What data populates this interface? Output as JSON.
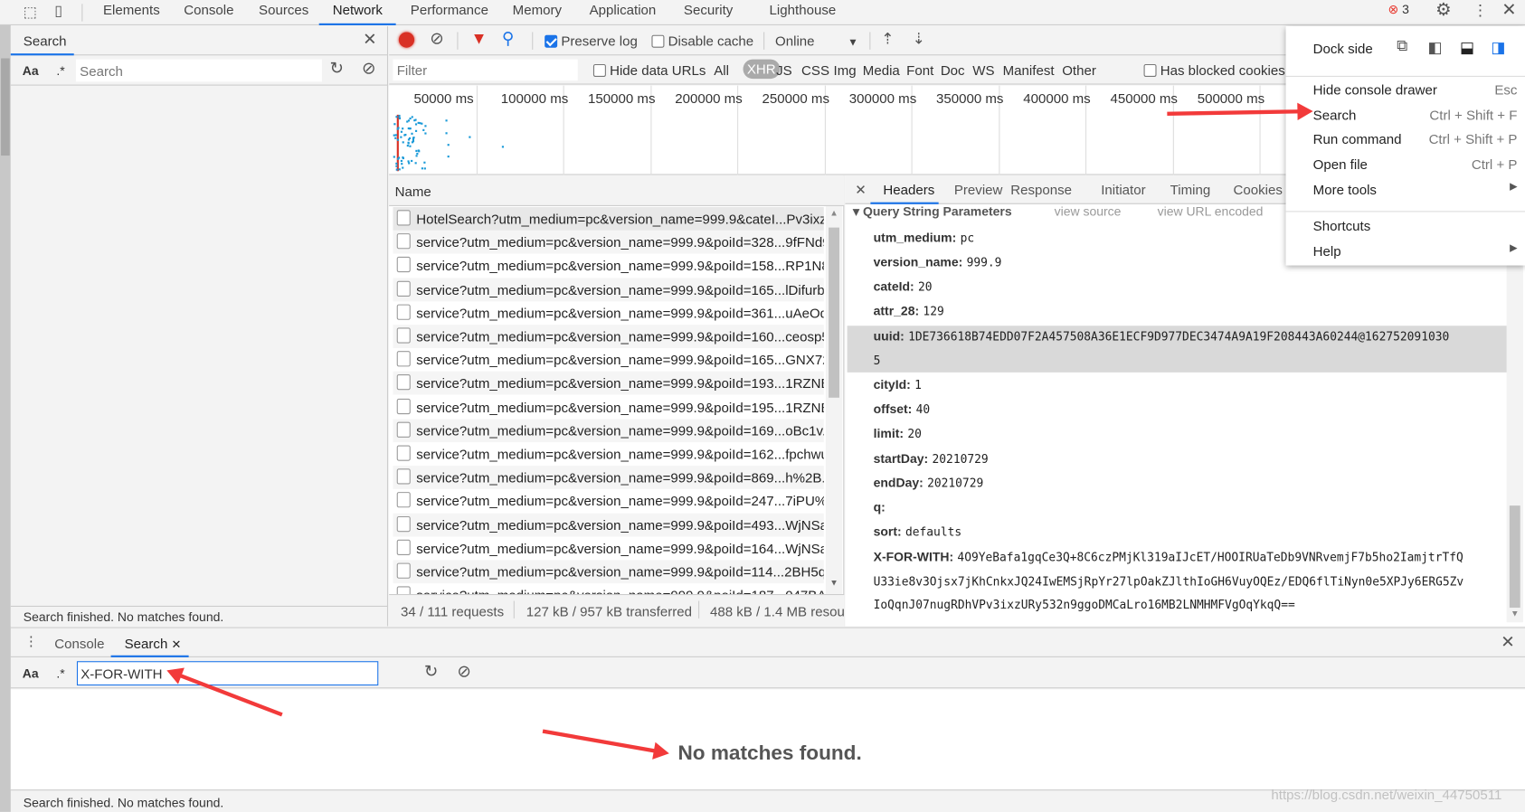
{
  "main_tabs": [
    "Elements",
    "Console",
    "Sources",
    "Network",
    "Performance",
    "Memory",
    "Application",
    "Security",
    "Lighthouse"
  ],
  "active_tab": "Network",
  "error_count": "3",
  "search_sidebar": {
    "title": "Search",
    "aa": "Aa",
    "regex": ".*",
    "placeholder": "Search",
    "status": "Search finished.  No matches found."
  },
  "network_toolbar": {
    "preserve_log": "Preserve log",
    "preserve_checked": true,
    "disable_cache": "Disable cache",
    "throttle": "Online"
  },
  "filter_bar": {
    "placeholder": "Filter",
    "hide_data_urls": "Hide data URLs",
    "types": [
      "All",
      "XHR",
      "JS",
      "CSS",
      "Img",
      "Media",
      "Font",
      "Doc",
      "WS",
      "Manifest",
      "Other"
    ],
    "active_type": "XHR",
    "blocked": "Has blocked cookies"
  },
  "timeline_ticks": [
    "50000 ms",
    "100000 ms",
    "150000 ms",
    "200000 ms",
    "250000 ms",
    "300000 ms",
    "350000 ms",
    "400000 ms",
    "450000 ms",
    "500000 ms",
    "5"
  ],
  "requests": {
    "header": "Name",
    "rows": [
      "HotelSearch?utm_medium=pc&version_name=999.9&cateI...Pv3ixzU",
      "service?utm_medium=pc&version_name=999.9&poiId=328...9fFNd9",
      "service?utm_medium=pc&version_name=999.9&poiId=158...RP1N8",
      "service?utm_medium=pc&version_name=999.9&poiId=165...lDifurb",
      "service?utm_medium=pc&version_name=999.9&poiId=361...uAeOd",
      "service?utm_medium=pc&version_name=999.9&poiId=160...ceosp5",
      "service?utm_medium=pc&version_name=999.9&poiId=165...GNX72",
      "service?utm_medium=pc&version_name=999.9&poiId=193...1RZNB",
      "service?utm_medium=pc&version_name=999.9&poiId=195...1RZNB",
      "service?utm_medium=pc&version_name=999.9&poiId=169...oBc1v..",
      "service?utm_medium=pc&version_name=999.9&poiId=162...fpchwu",
      "service?utm_medium=pc&version_name=999.9&poiId=869...h%2B..",
      "service?utm_medium=pc&version_name=999.9&poiId=247...7iPU%2",
      "service?utm_medium=pc&version_name=999.9&poiId=493...WjNSa.",
      "service?utm_medium=pc&version_name=999.9&poiId=164...WjNSa.",
      "service?utm_medium=pc&version_name=999.9&poiId=114...2BH5q.",
      "service?utm_medium=pc&version_name=999.9&poiId=187...047BA1"
    ],
    "summary": [
      "34 / 111 requests",
      "127 kB / 957 kB transferred",
      "488 kB / 1.4 MB resou"
    ]
  },
  "detail": {
    "tabs": [
      "Headers",
      "Preview",
      "Response",
      "Initiator",
      "Timing",
      "Cookies"
    ],
    "active": "Headers",
    "section": "Query String Parameters",
    "view_source": "view source",
    "view_url_encoded": "view URL encoded",
    "params": [
      {
        "k": "utm_medium:",
        "v": "pc"
      },
      {
        "k": "version_name:",
        "v": "999.9"
      },
      {
        "k": "cateId:",
        "v": "20"
      },
      {
        "k": "attr_28:",
        "v": "129"
      },
      {
        "k": "uuid:",
        "v": "1DE736618B74EDD07F2A457508A36E1ECF9D977DEC3474A9A19F208443A60244@162752091030",
        "v2": "5"
      },
      {
        "k": "cityId:",
        "v": "1"
      },
      {
        "k": "offset:",
        "v": "40"
      },
      {
        "k": "limit:",
        "v": "20"
      },
      {
        "k": "startDay:",
        "v": "20210729"
      },
      {
        "k": "endDay:",
        "v": "20210729"
      },
      {
        "k": "q:",
        "v": ""
      },
      {
        "k": "sort:",
        "v": "defaults"
      },
      {
        "k": "X-FOR-WITH:",
        "v": "4O9YeBafa1gqCe3Q+8C6czPMjKl319aIJcET/HOOIRUaTeDb9VNRvemjF7b5ho2IamjtrTfQ",
        "v2": "U33ie8v3Ojsx7jKhCnkxJQ24IwEMSjRpYr27lpOakZJlthIoGH6VuyOQEz/EDQ6flTiNyn0e5XPJy6ERG5Zv",
        "v3": "IoQqnJ07nugRDhVPv3ixzURy532n9ggoDMCaLro16MB2LNMHMFVgOqYkqQ=="
      }
    ]
  },
  "menu": {
    "dock_side": "Dock side",
    "items": [
      {
        "label": "Hide console drawer",
        "shortcut": "Esc"
      },
      {
        "label": "Search",
        "shortcut": "Ctrl + Shift + F"
      },
      {
        "label": "Run command",
        "shortcut": "Ctrl + Shift + P"
      },
      {
        "label": "Open file",
        "shortcut": "Ctrl + P"
      },
      {
        "label": "More tools",
        "shortcut": ""
      },
      {
        "label": "Shortcuts",
        "shortcut": ""
      },
      {
        "label": "Help",
        "shortcut": ""
      }
    ]
  },
  "drawer": {
    "tabs": [
      "Console",
      "Search"
    ],
    "active": "Search",
    "aa": "Aa",
    "regex": ".*",
    "query": "X-FOR-WITH",
    "no_matches": "No matches found.",
    "status": "Search finished.  No matches found."
  },
  "watermark": "https://blog.csdn.net/weixin_44750511",
  "colors": {
    "accent": "#1a73e8",
    "record": "#d93025",
    "arrow": "#f23a3a"
  }
}
